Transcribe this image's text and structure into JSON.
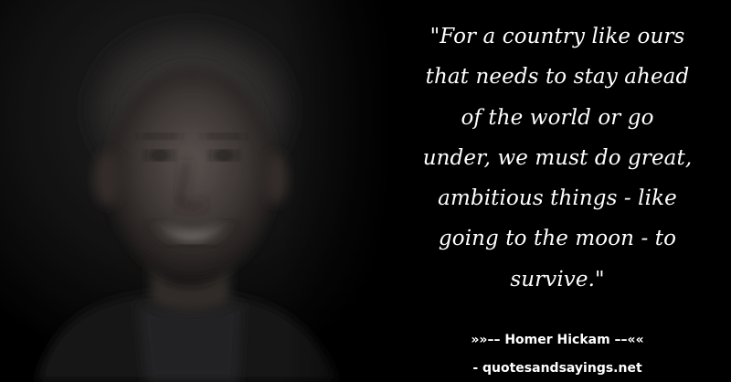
{
  "quote": {
    "lines": [
      "\"For a country like ours",
      "that needs to stay ahead",
      "of the world or go",
      "under, we must do great,",
      "ambitious things - like",
      "going to the moon - to",
      "survive.\""
    ]
  },
  "attribution": {
    "author_line": "»»–– Homer Hickam ––««",
    "source_line": "- quotesandsayings.net"
  },
  "colors": {
    "background": "#000000",
    "text": "#ffffff"
  }
}
